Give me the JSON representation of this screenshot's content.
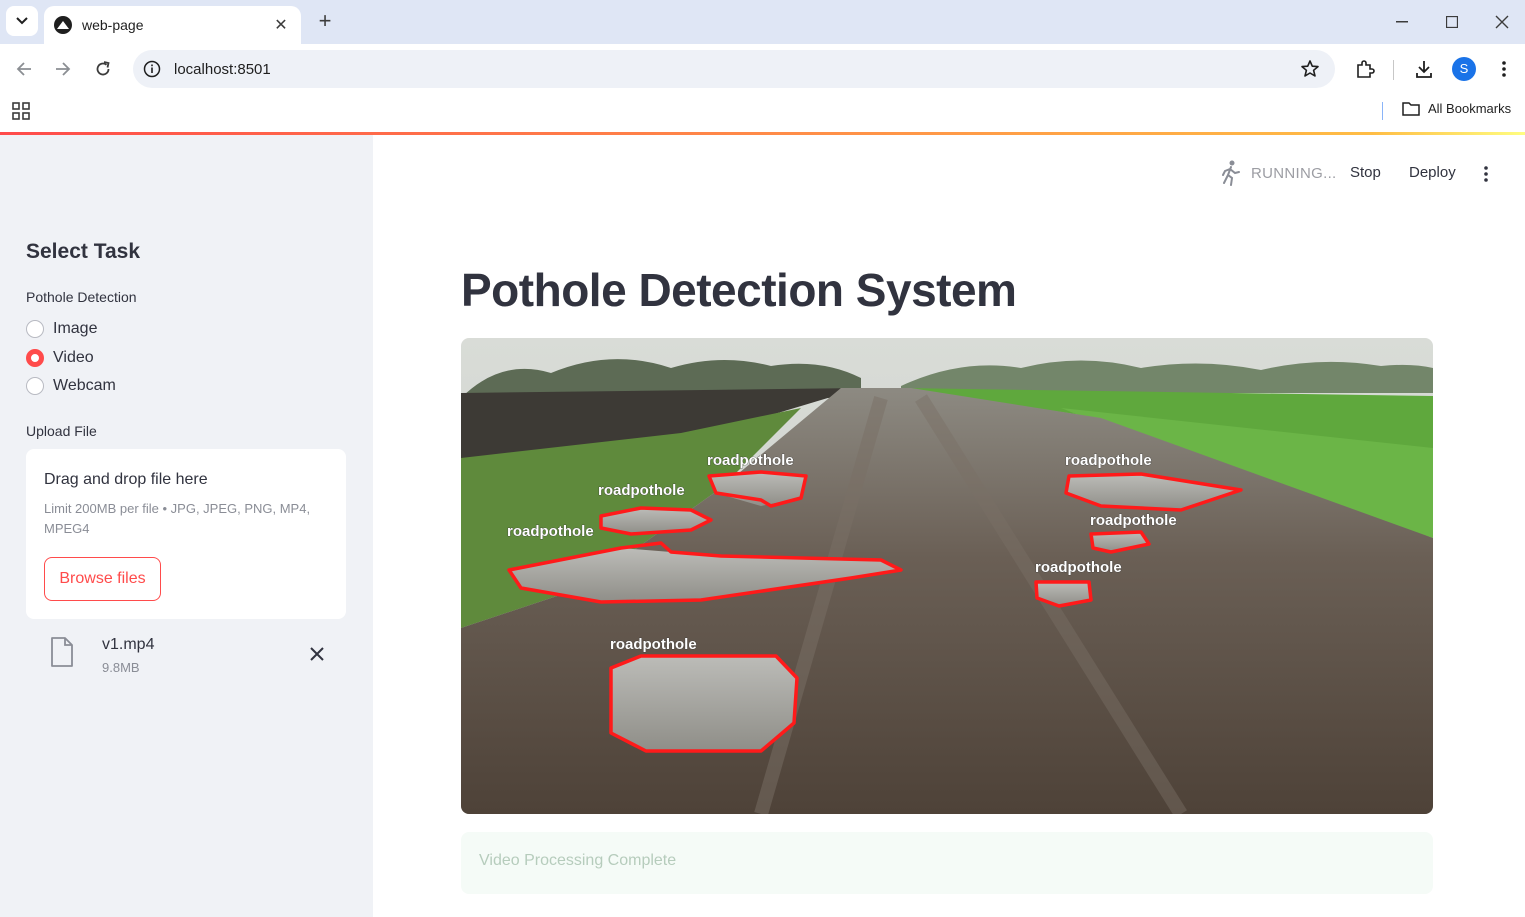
{
  "browser": {
    "tab_title": "web-page",
    "url": "localhost:8501",
    "all_bookmarks": "All Bookmarks",
    "profile_initial": "S"
  },
  "app": {
    "status_text": "RUNNING...",
    "stop_label": "Stop",
    "deploy_label": "Deploy",
    "title": "Pothole Detection System",
    "success_message": "Video Processing Complete"
  },
  "sidebar": {
    "heading": "Select Task",
    "radio_label": "Pothole Detection",
    "options": [
      {
        "label": "Image",
        "selected": false
      },
      {
        "label": "Video",
        "selected": true
      },
      {
        "label": "Webcam",
        "selected": false
      }
    ],
    "upload_label": "Upload File",
    "uploader": {
      "title": "Drag and drop file here",
      "limit": "Limit 200MB per file • JPG, JPEG, PNG, MP4, MPEG4",
      "button": "Browse files"
    },
    "file": {
      "name": "v1.mp4",
      "size": "9.8MB"
    }
  },
  "detections": [
    {
      "label": "roadpothole"
    },
    {
      "label": "roadpothole"
    },
    {
      "label": "roadpothole"
    },
    {
      "label": "roadpothole"
    },
    {
      "label": "roadpothole"
    },
    {
      "label": "roadpothole"
    },
    {
      "label": "roadpothole"
    }
  ],
  "colors": {
    "accent": "#ff4b4b",
    "sidebar_bg": "#f0f2f6",
    "detection_box": "#ff0000"
  }
}
